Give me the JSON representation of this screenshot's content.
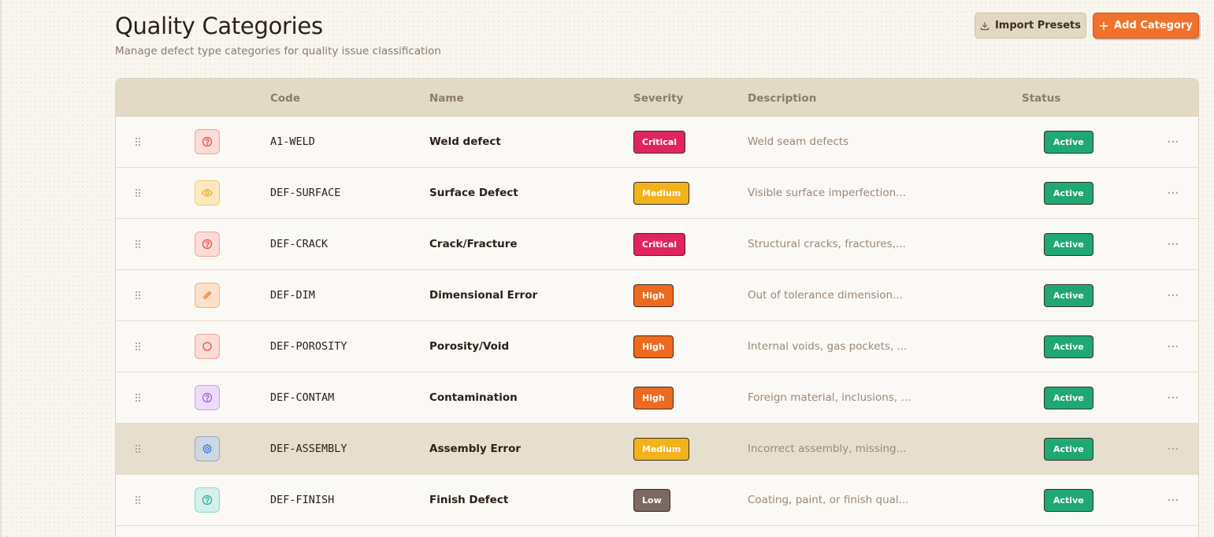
{
  "header": {
    "title": "Quality Categories",
    "subtitle": "Manage defect type categories for quality issue classification",
    "import_label": "Import Presets",
    "add_label": "Add Category"
  },
  "table": {
    "columns": [
      "",
      "",
      "Code",
      "Name",
      "Severity",
      "Description",
      "Status",
      ""
    ],
    "rows": [
      {
        "icon": "help-circle-icon",
        "code": "A1-WELD",
        "name": "Weld defect",
        "severity": "Critical",
        "description": "Weld seam defects",
        "status": "Active",
        "tone": "red"
      },
      {
        "icon": "eye-icon",
        "code": "DEF-SURFACE",
        "name": "Surface Defect",
        "severity": "Medium",
        "description": "Visible surface imperfection...",
        "status": "Active",
        "tone": "yellow"
      },
      {
        "icon": "help-circle-icon",
        "code": "DEF-CRACK",
        "name": "Crack/Fracture",
        "severity": "Critical",
        "description": "Structural cracks, fractures,...",
        "status": "Active",
        "tone": "red"
      },
      {
        "icon": "ruler-icon",
        "code": "DEF-DIM",
        "name": "Dimensional Error",
        "severity": "High",
        "description": "Out of tolerance dimension...",
        "status": "Active",
        "tone": "orange"
      },
      {
        "icon": "circle-icon",
        "code": "DEF-POROSITY",
        "name": "Porosity/Void",
        "severity": "High",
        "description": "Internal voids, gas pockets, ...",
        "status": "Active",
        "tone": "red"
      },
      {
        "icon": "help-circle-icon",
        "code": "DEF-CONTAM",
        "name": "Contamination",
        "severity": "High",
        "description": "Foreign material, inclusions, ...",
        "status": "Active",
        "tone": "purple"
      },
      {
        "icon": "gear-icon",
        "code": "DEF-ASSEMBLY",
        "name": "Assembly Error",
        "severity": "Medium",
        "description": "Incorrect assembly, missing...",
        "status": "Active",
        "tone": "blue"
      },
      {
        "icon": "help-circle-icon",
        "code": "DEF-FINISH",
        "name": "Finish Defect",
        "severity": "Low",
        "description": "Coating, paint, or finish qual...",
        "status": "Active",
        "tone": "teal"
      }
    ]
  },
  "colors": {
    "accent": "#f0722a",
    "critical": "#e0245e",
    "medium": "#f2b21c",
    "high": "#ee6a1e",
    "low": "#7b6962",
    "active": "#1fa874"
  }
}
